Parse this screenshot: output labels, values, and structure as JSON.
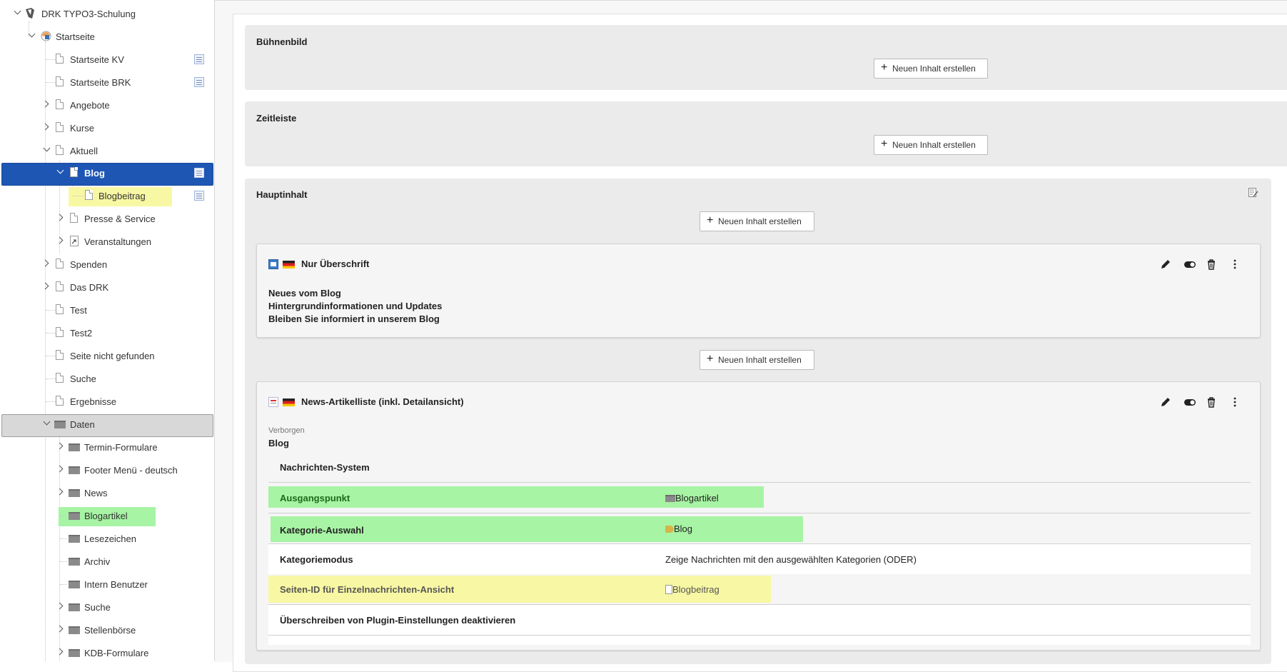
{
  "tree": {
    "root": "DRK TYPO3-Schulung",
    "startseite": "Startseite",
    "items": [
      {
        "label": "Startseite KV"
      },
      {
        "label": "Startseite BRK"
      },
      {
        "label": "Angebote"
      },
      {
        "label": "Kurse"
      },
      {
        "label": "Aktuell"
      },
      {
        "label": "Blog"
      },
      {
        "label": "Blogbeitrag"
      },
      {
        "label": "Presse & Service"
      },
      {
        "label": "Veranstaltungen"
      },
      {
        "label": "Spenden"
      },
      {
        "label": "Das DRK"
      },
      {
        "label": "Test"
      },
      {
        "label": "Test2"
      },
      {
        "label": "Seite nicht gefunden"
      },
      {
        "label": "Suche"
      },
      {
        "label": "Ergebnisse"
      },
      {
        "label": "Daten"
      },
      {
        "label": "Termin-Formulare"
      },
      {
        "label": "Footer Menü - deutsch"
      },
      {
        "label": "News"
      },
      {
        "label": "Blogartikel"
      },
      {
        "label": "Lesezeichen"
      },
      {
        "label": "Archiv"
      },
      {
        "label": "Intern Benutzer"
      },
      {
        "label": "Suche"
      },
      {
        "label": "Stellenbörse"
      },
      {
        "label": "KDB-Formulare"
      }
    ]
  },
  "columns": {
    "buehnenbild": {
      "title": "Bühnenbild"
    },
    "zeitleiste": {
      "title": "Zeitleiste"
    },
    "hauptinhalt": {
      "title": "Hauptinhalt"
    },
    "new_content_label": "Neuen Inhalt erstellen"
  },
  "elements": [
    {
      "type_label": "Nur Überschrift",
      "lines": [
        "Neues vom Blog",
        "Hintergrundinformationen und Updates",
        "Bleiben Sie informiert in unserem Blog"
      ]
    },
    {
      "type_label": "News-Artikelliste (inkl. Detailansicht)",
      "status": "Verborgen",
      "header": "Blog",
      "rows": [
        {
          "key": "Nachrichten-System",
          "value": ""
        },
        {
          "key": "Ausgangspunkt",
          "value": "Blogartikel"
        },
        {
          "key": "Kategorie-Auswahl",
          "value": "Blog"
        },
        {
          "key": "Kategoriemodus",
          "value": "Zeige Nachrichten mit den ausgewählten Kategorien (ODER)"
        },
        {
          "key": "Seiten-ID für Einzelnachrichten-Ansicht",
          "value": "Blogbeitrag"
        },
        {
          "key": "Überschreiben von Plugin-Einstellungen deaktivieren",
          "value": ""
        }
      ]
    }
  ],
  "colors": {
    "selected": "#1e56b4",
    "highlight_yellow": "#f8f8a4",
    "highlight_green": "#a7f4a4"
  }
}
